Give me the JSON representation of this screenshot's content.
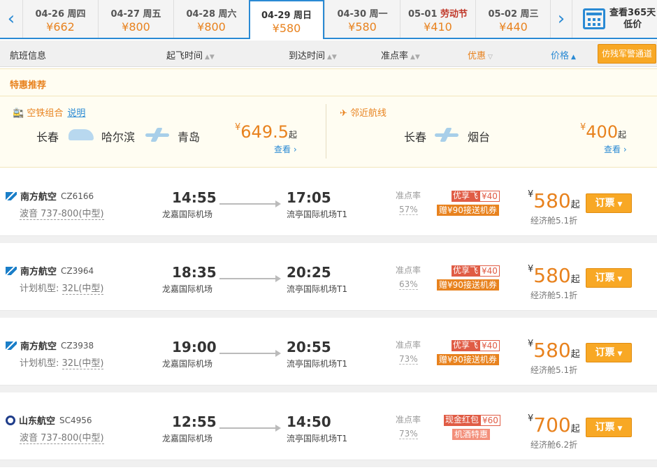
{
  "dates": [
    {
      "label": "04-26 周四",
      "price": "¥662"
    },
    {
      "label": "04-27 周五",
      "price": "¥800"
    },
    {
      "label": "04-28 周六",
      "price": "¥800"
    },
    {
      "label": "04-29 周日",
      "price": "¥580",
      "active": true
    },
    {
      "label": "04-30 周一",
      "price": "¥580"
    },
    {
      "label_date": "05-01 ",
      "label_holiday": "劳动节",
      "price": "¥410"
    },
    {
      "label": "05-02 周三",
      "price": "¥440"
    }
  ],
  "nav": {
    "prev": "‹",
    "next": "›"
  },
  "calendar": {
    "line1": "查看365天",
    "line2": "低价"
  },
  "sort": {
    "info": "航班信息",
    "depart": "起飞时间",
    "arrive": "到达时间",
    "ontime": "准点率",
    "discount": "优惠",
    "price": "价格",
    "transfer": "仿残军警通道"
  },
  "promo": {
    "title": "特惠推荐",
    "combo": {
      "label": "空铁组合",
      "link": "说明",
      "city1": "长春",
      "city2": "哈尔滨",
      "city3": "青岛",
      "yen": "¥",
      "price": "649.5",
      "qi": "起",
      "view": "查看"
    },
    "nearby": {
      "label": "邻近航线",
      "city1": "长春",
      "city2": "烟台",
      "yen": "¥",
      "price": "400",
      "qi": "起",
      "view": "查看"
    }
  },
  "flights": [
    {
      "airline": "南方航空",
      "logo": "cz",
      "no": "CZ6166",
      "aircraft_prefix": "",
      "aircraft": "波音 737-800(中型)",
      "dep": "14:55",
      "dep_airport": "龙嘉国际机场",
      "arr": "17:05",
      "arr_airport": "流亭国际机场T1",
      "ontime_label": "准点率",
      "ontime": "57%",
      "tag1_l": "优享飞",
      "tag1_r": "¥40",
      "tag2": "赠¥90接送机券",
      "tag2_style": "b",
      "yen": "¥",
      "price": "580",
      "qi": "起",
      "cabin": "经济舱5.1折",
      "book": "订票"
    },
    {
      "airline": "南方航空",
      "logo": "cz",
      "no": "CZ3964",
      "aircraft_prefix": "计划机型:",
      "aircraft": "32L(中型)",
      "dep": "18:35",
      "dep_airport": "龙嘉国际机场",
      "arr": "20:25",
      "arr_airport": "流亭国际机场T1",
      "ontime_label": "准点率",
      "ontime": "63%",
      "tag1_l": "优享飞",
      "tag1_r": "¥40",
      "tag2": "赠¥90接送机券",
      "tag2_style": "b",
      "yen": "¥",
      "price": "580",
      "qi": "起",
      "cabin": "经济舱5.1折",
      "book": "订票"
    },
    {
      "airline": "南方航空",
      "logo": "cz",
      "no": "CZ3938",
      "aircraft_prefix": "计划机型:",
      "aircraft": "32L(中型)",
      "dep": "19:00",
      "dep_airport": "龙嘉国际机场",
      "arr": "20:55",
      "arr_airport": "流亭国际机场T1",
      "ontime_label": "准点率",
      "ontime": "73%",
      "tag1_l": "优享飞",
      "tag1_r": "¥40",
      "tag2": "赠¥90接送机券",
      "tag2_style": "b",
      "yen": "¥",
      "price": "580",
      "qi": "起",
      "cabin": "经济舱5.1折",
      "book": "订票"
    },
    {
      "airline": "山东航空",
      "logo": "sc",
      "no": "SC4956",
      "aircraft_prefix": "",
      "aircraft": "波音 737-800(中型)",
      "dep": "12:55",
      "dep_airport": "龙嘉国际机场",
      "arr": "14:50",
      "arr_airport": "流亭国际机场T1",
      "ontime_label": "准点率",
      "ontime": "73%",
      "tag1_l": "现金红包",
      "tag1_r": "¥60",
      "tag2": "机酒特惠",
      "tag2_style": "c",
      "yen": "¥",
      "price": "700",
      "qi": "起",
      "cabin": "经济舱6.2折",
      "book": "订票"
    }
  ]
}
